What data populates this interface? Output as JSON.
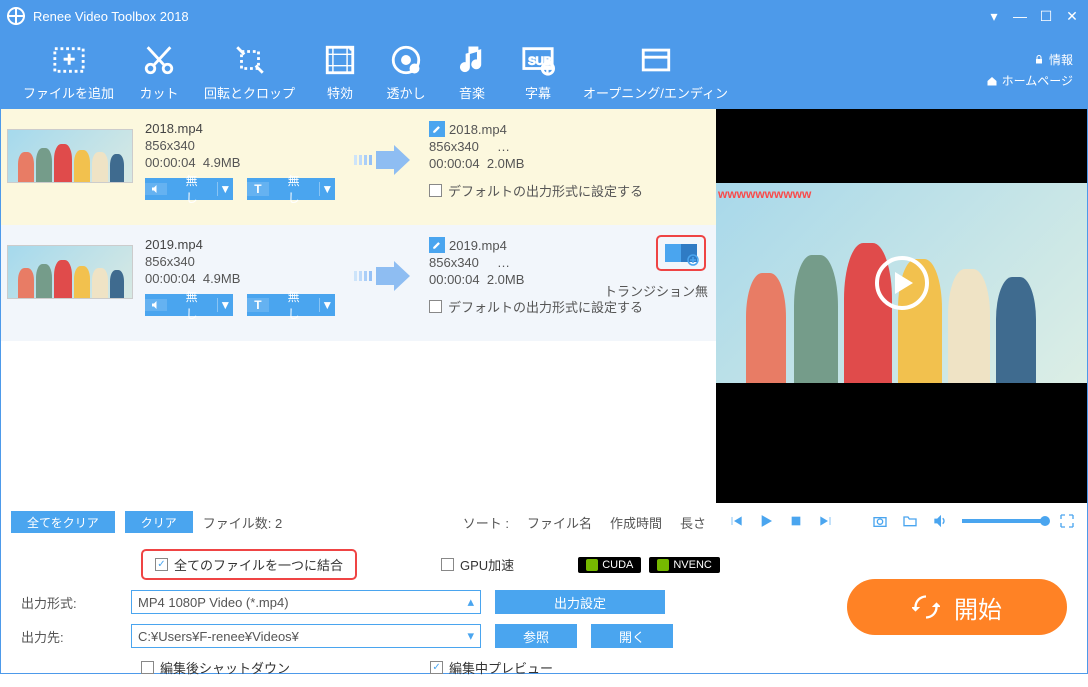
{
  "app": {
    "title": "Renee Video Toolbox 2018"
  },
  "topLinks": {
    "info": "情報",
    "home": "ホームページ"
  },
  "toolbar": [
    {
      "label": "ファイルを追加"
    },
    {
      "label": "カット"
    },
    {
      "label": "回転とクロップ"
    },
    {
      "label": "特効"
    },
    {
      "label": "透かし"
    },
    {
      "label": "音楽"
    },
    {
      "label": "字幕"
    },
    {
      "label": "オープニング/エンディン"
    }
  ],
  "files": [
    {
      "in": {
        "name": "2018.mp4",
        "res": "856x340",
        "dur": "00:00:04",
        "size": "4.9MB"
      },
      "out": {
        "name": "2018.mp4",
        "res": "856x340",
        "ellipsis": "…",
        "dur": "00:00:04",
        "size": "2.0MB"
      },
      "audio": "無し",
      "sub": "無し",
      "defaultOut": "デフォルトの出力形式に設定する"
    },
    {
      "in": {
        "name": "2019.mp4",
        "res": "856x340",
        "dur": "00:00:04",
        "size": "4.9MB"
      },
      "out": {
        "name": "2019.mp4",
        "res": "856x340",
        "ellipsis": "…",
        "dur": "00:00:04",
        "size": "2.0MB"
      },
      "audio": "無し",
      "sub": "無し",
      "defaultOut": "デフォルトの出力形式に設定する",
      "transition": "トランジション無"
    }
  ],
  "listfoot": {
    "clearAll": "全てをクリア",
    "clear": "クリア",
    "countLabel": "ファイル数:  2",
    "sortLabel": "ソート :",
    "byName": "ファイル名",
    "byTime": "作成時間",
    "byLen": "長さ"
  },
  "preview": {
    "watermark": "wwwwwwwwww"
  },
  "bottom": {
    "merge": "全てのファイルを一つに結合",
    "gpu": "GPU加速",
    "cuda": "CUDA",
    "nvenc": "NVENC",
    "outFmtLabel": "出力形式:",
    "outFmtValue": "MP4 1080P Video (*.mp4)",
    "outFmtSettings": "出力設定",
    "outDirLabel": "出力先:",
    "outDirValue": "C:¥Users¥F-renee¥Videos¥",
    "browse": "参照",
    "open": "開く",
    "shutdown": "編集後シャットダウン",
    "previewing": "編集中プレビュー",
    "start": "開始"
  }
}
